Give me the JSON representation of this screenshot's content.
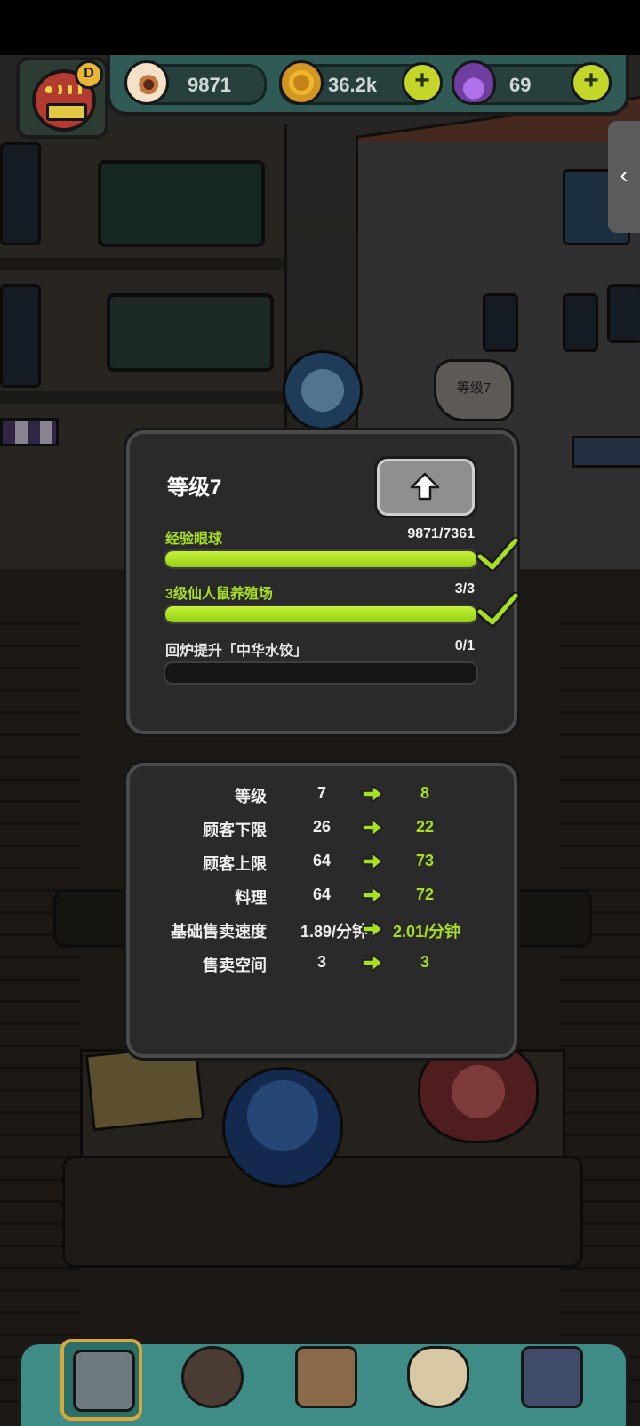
{
  "hud": {
    "avatar_badge": "D",
    "eyeballs": "9871",
    "coins": "36.2k",
    "potions": "69",
    "plus_label": "+"
  },
  "side_tab": {
    "icon": "‹"
  },
  "building_sign": "等级7",
  "upgrade": {
    "title": "等级7",
    "requirements": [
      {
        "label": "经验眼球",
        "count": "9871/7361",
        "progress": 1.0,
        "done": true
      },
      {
        "label": "3级仙人鼠养殖场",
        "count": "3/3",
        "progress": 1.0,
        "done": true
      },
      {
        "label": "回炉提升「中华水饺」",
        "count": "0/1",
        "progress": 0.0,
        "done": false
      }
    ]
  },
  "stats": [
    {
      "name": "等级",
      "current": "7",
      "next": "8"
    },
    {
      "name": "顾客下限",
      "current": "26",
      "next": "22"
    },
    {
      "name": "顾客上限",
      "current": "64",
      "next": "73"
    },
    {
      "name": "料理",
      "current": "64",
      "next": "72"
    },
    {
      "name": "基础售卖速度",
      "current": "1.89/分钟",
      "next": "2.01/分钟"
    },
    {
      "name": "售卖空间",
      "current": "3",
      "next": "3"
    }
  ],
  "nav": [
    {
      "icon": "shop-building-icon",
      "active": true
    },
    {
      "icon": "cauldron-monster-icon",
      "active": false
    },
    {
      "icon": "recipe-book-icon",
      "active": false
    },
    {
      "icon": "money-bag-icon",
      "active": false
    },
    {
      "icon": "monster-grid-icon",
      "active": false
    }
  ],
  "colors": {
    "accent_green": "#a6e01e",
    "panel_bg": "#2a2a2a",
    "hud_teal": "#2f5a55"
  }
}
